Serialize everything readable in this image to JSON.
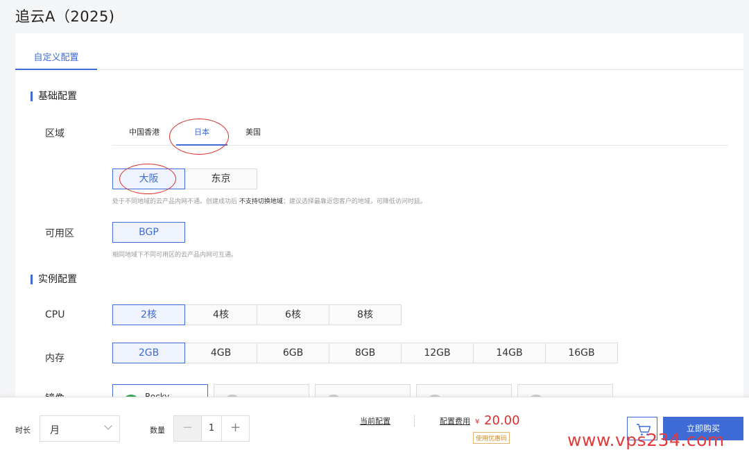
{
  "page_title": "追云A（2025)",
  "tabs": [
    {
      "label": "自定义配置"
    }
  ],
  "sections": {
    "basic": "基础配置",
    "instance": "实例配置"
  },
  "labels": {
    "region": "区域",
    "zone": "可用区",
    "cpu": "CPU",
    "memory": "内存",
    "image": "镜像"
  },
  "region_tabs": [
    {
      "label": "中国香港"
    },
    {
      "label": "日本",
      "active": true
    },
    {
      "label": "美国"
    }
  ],
  "cities": [
    {
      "label": "大阪",
      "selected": true
    },
    {
      "label": "东京"
    }
  ],
  "region_hint": {
    "prefix": "处于不同地域的云产品内网不通。创建成功后",
    "bold": "不支持切换地域",
    "suffix": "；建议选择最靠近您客户的地域，可降低访问时延。"
  },
  "zones": [
    {
      "label": "BGP",
      "selected": true
    }
  ],
  "zone_hint": "相同地域下不同可用区的云产品内网可互通。",
  "cpu_options": [
    {
      "label": "2核",
      "selected": true
    },
    {
      "label": "4核"
    },
    {
      "label": "6核"
    },
    {
      "label": "8核"
    }
  ],
  "memory_options": [
    {
      "label": "2GB",
      "selected": true
    },
    {
      "label": "4GB"
    },
    {
      "label": "6GB"
    },
    {
      "label": "8GB"
    },
    {
      "label": "12GB"
    },
    {
      "label": "14GB"
    },
    {
      "label": "16GB"
    }
  ],
  "image_options": [
    {
      "label": "Rocky",
      "selected": true
    },
    {
      "label": ""
    },
    {
      "label": ""
    },
    {
      "label": ""
    },
    {
      "label": ""
    }
  ],
  "footer": {
    "duration_label": "时长",
    "duration_value": "月",
    "quantity_label": "数量",
    "quantity_minus": "−",
    "quantity_value": "1",
    "quantity_plus": "+",
    "current_config": "当前配置",
    "fee_label": "配置费用",
    "currency": "¥",
    "price": "20.00",
    "coupon": "使用优惠码",
    "buy": "立即购买"
  },
  "watermark": "www.vps234.com",
  "colors": {
    "accent": "#3e6bd6",
    "price": "#d9302b",
    "annotation_circle": "#d9302b",
    "coupon": "#d98b1f"
  },
  "icons": {
    "cart": "cart-icon",
    "chevron": "chevron-down-icon"
  }
}
